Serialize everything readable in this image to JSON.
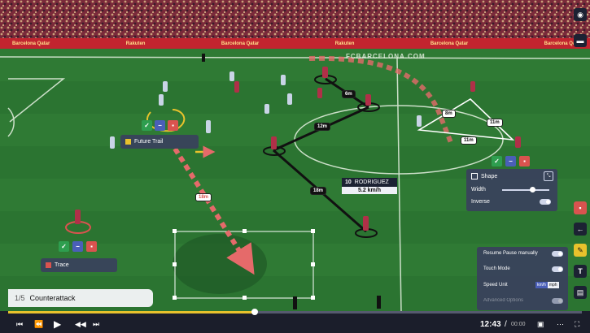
{
  "board": {
    "name": "Barcelona Qatar",
    "sponsor": "Rakuten"
  },
  "web_text": "FCBARCELONA.COM",
  "future_trail": {
    "label": "Future Trail"
  },
  "trace": {
    "label": "Trace"
  },
  "distances": [
    "6m",
    "12m",
    "18m",
    "18m",
    "8m",
    "11m",
    "11m"
  ],
  "player_tag": {
    "number": "10",
    "name": "RODRIGUEZ",
    "speed": "5.2 km/h"
  },
  "shape_panel": {
    "title": "Shape",
    "width_label": "Width",
    "inverse_label": "Inverse"
  },
  "settings_panel": {
    "resume_label": "Resume Pause manually",
    "touch_label": "Touch Mode",
    "speed_label": "Speed Unit",
    "speed_options": [
      "km/h",
      "mph"
    ],
    "extra_label": "Advanced Options"
  },
  "clip": {
    "counter": "1/5",
    "title": "Counterattack"
  },
  "player_time": {
    "current": "12:43",
    "total": "00:00"
  },
  "progress": 0.43,
  "colors": {
    "pitch": "#2f7a34",
    "panel": "#3a405c",
    "accent": "#e8c22c",
    "trail": "#e56a6a"
  }
}
